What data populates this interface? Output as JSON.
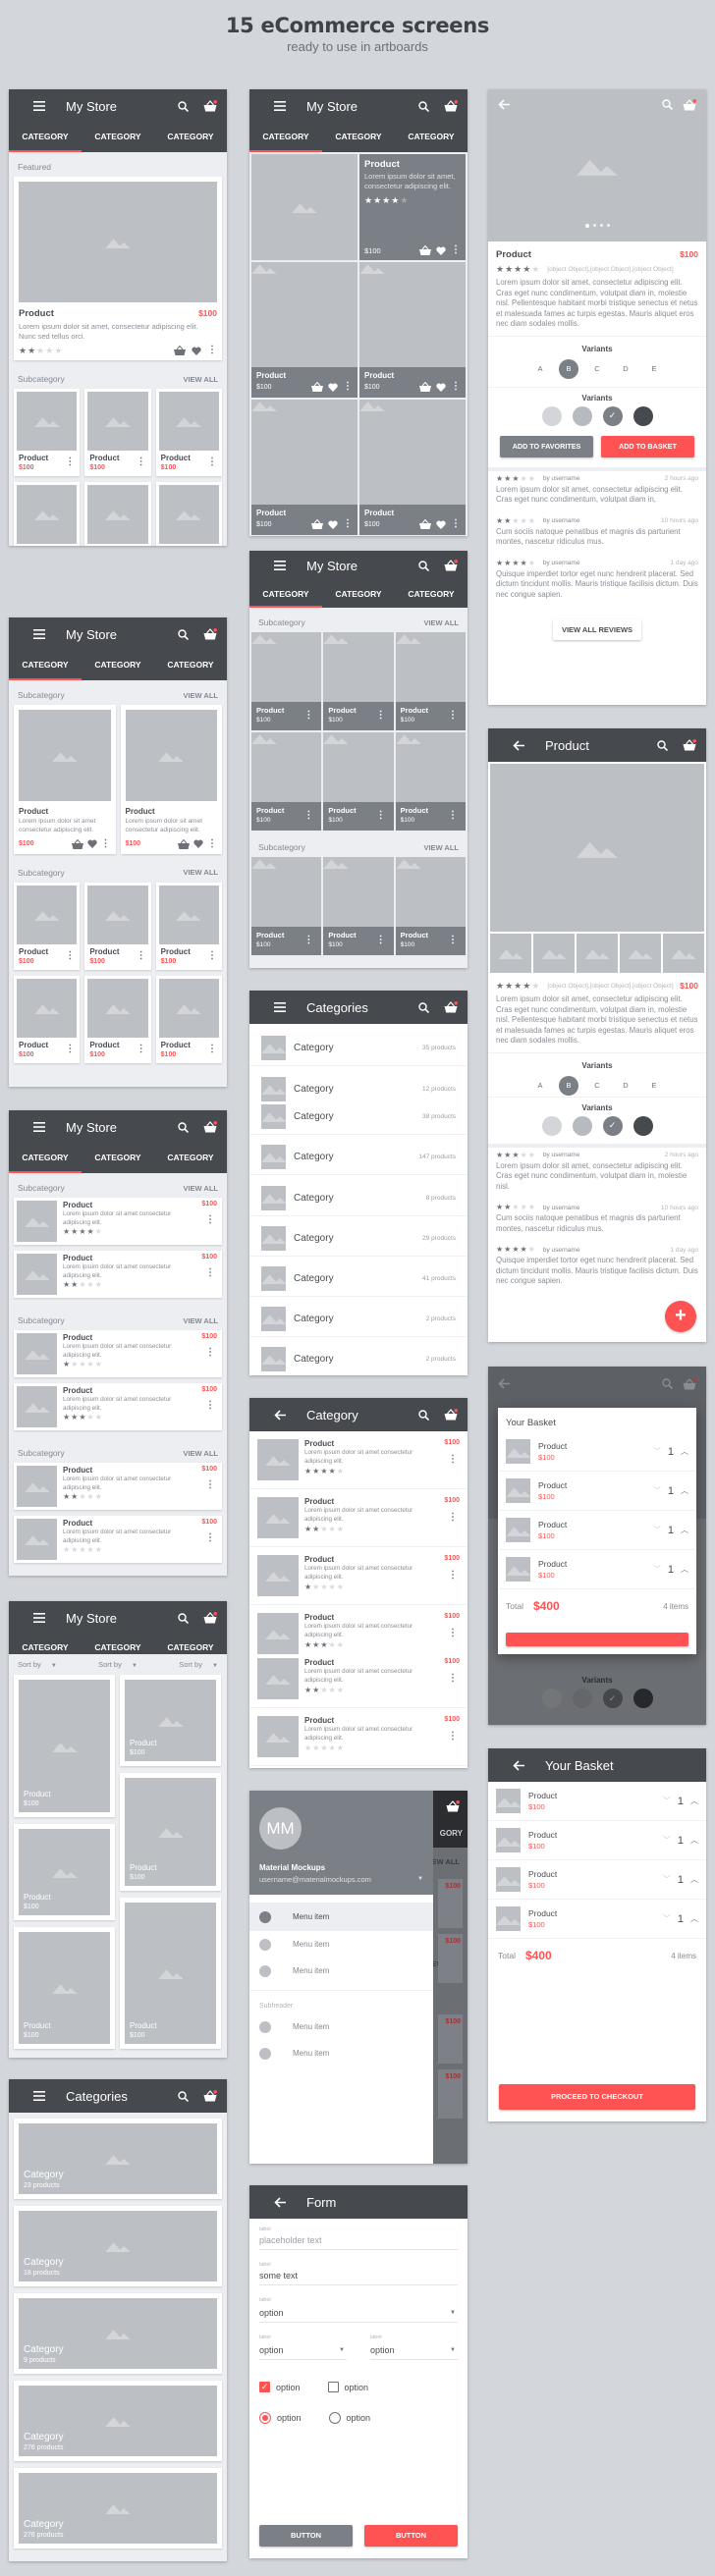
{
  "header": {
    "title": "15 eCommerce screens",
    "subtitle": "ready to use in artboards"
  },
  "colors": {
    "accent": "#ff5252",
    "appbar": "#46494e",
    "placeholder": "#bcbfc4"
  },
  "common": {
    "store_title": "My Store",
    "tab_label": "CATEGORY",
    "product": "Product",
    "price": "$100",
    "subcategory": "Subcategory",
    "view_all": "VIEW ALL",
    "featured": "Featured",
    "lorem_short": "Lorem ipsum dolor sit amet consectetur adipiscing elit.",
    "lorem_featured": "Lorem ipsum dolor sit amet, consectetur adipiscing elit. Nunc sed tellus orci.",
    "lorem_tile": "Lorem ipsum dolor sit amet, consectetur adipiscing elit.",
    "sort_by": "Sort by",
    "category": "Category"
  },
  "screen1": {
    "featured_rating": 2,
    "grid_count": 6
  },
  "screen2": {
    "featured_rating": 4
  },
  "screen_list": {
    "sections": [
      {
        "ratings": [
          4,
          2
        ]
      },
      {
        "ratings": [
          1,
          3
        ]
      },
      {
        "ratings": [
          2,
          0
        ]
      }
    ]
  },
  "categories_cards": {
    "title": "Categories",
    "items": [
      {
        "name": "Category",
        "count": "23 products"
      },
      {
        "name": "Category",
        "count": "18 products"
      },
      {
        "name": "Category",
        "count": "9 products"
      },
      {
        "name": "Category",
        "count": "276 products"
      },
      {
        "name": "Category",
        "count": "276 products"
      }
    ]
  },
  "categories_list": {
    "title": "Categories",
    "items": [
      {
        "name": "Category",
        "count": "35 products"
      },
      {
        "name": "Category",
        "count": "12 products"
      },
      {
        "name": "Category",
        "count": "38 products"
      },
      {
        "name": "Category",
        "count": "147 products"
      },
      {
        "name": "Category",
        "count": "8 products"
      },
      {
        "name": "Category",
        "count": "29 products"
      },
      {
        "name": "Category",
        "count": "41 products"
      },
      {
        "name": "Category",
        "count": "2 products"
      },
      {
        "name": "Category",
        "count": "2 products"
      }
    ]
  },
  "category_screen": {
    "title": "Category",
    "ratings": [
      4,
      2,
      1,
      3,
      2,
      0
    ]
  },
  "drawer": {
    "initials": "MM",
    "name": "Material Mockups",
    "email": "username@materialmockups.com",
    "items": [
      "Menu item",
      "Menu item",
      "Menu item"
    ],
    "subheader": "Subheader",
    "sub_items": [
      "Menu item",
      "Menu item"
    ],
    "behind_tab": "GORY",
    "behind_view_all": "EW ALL"
  },
  "form": {
    "title": "Form",
    "label": "label",
    "field1_placeholder": "placeholder text",
    "field2_value": "some text",
    "select_value": "option",
    "checkbox_label": "option",
    "radio_label": "option",
    "button1": "BUTTON",
    "button2": "BUTTON"
  },
  "product_detail": {
    "name": "Product",
    "price": "$100",
    "rating": 4,
    "reviews": [
      {
        "rating": 3,
        "by": "by username",
        "time": "2 hours ago",
        "text": "Lorem ipsum dolor sit amet, consectetur adipiscing elit. Cras eget nunc condimentum, volutpat diam in,"
      },
      {
        "rating": 2,
        "by": "by username",
        "time": "10 hours ago",
        "text": "Cum sociis natoque penatibus et magnis dis parturient montes, nascetur ridiculus mus."
      },
      {
        "rating": 4,
        "by": "by username",
        "time": "1 day ago",
        "text": "Quisque imperdiet tortor eget nunc hendrerit placerat. Sed dictum tincidunt mollis. Mauris tristique facilisis dictum.  Duis nec congue sapien."
      }
    ],
    "description": "Lorem ipsum dolor sit amet, consectetur adipiscing elit. Cras eget nunc condimentum, volutpat diam in, molestie nisl. Pellentesque habitant morbi tristique senectus et netus et malesuada fames ac turpis egestas. Mauris aliquet eros nec diam sodales mollis.",
    "variants_label": "Variants",
    "letter_variants": [
      "A",
      "B",
      "C",
      "D",
      "E"
    ],
    "selected_letter": "B",
    "color_variants": [
      "#d3d5d9",
      "#b7babf",
      "#7b7f86",
      "#46494e"
    ],
    "selected_color_index": 2,
    "add_favorites": "ADD TO FAVORITES",
    "add_basket": "ADD TO BASKET",
    "view_all_reviews": "VIEW ALL REVIEWS",
    "carousel_pages": 4,
    "carousel_current": 1
  },
  "product_detail2": {
    "title": "Product",
    "review1_text": "Lorem ipsum dolor sit amet, consectetur adipiscing elit. Cras eget nunc condimentum, volutpat diam in, molestie nisl.",
    "fab": "+"
  },
  "basket": {
    "title": "Your Basket",
    "items": [
      {
        "name": "Product",
        "price": "$100",
        "qty": "1"
      },
      {
        "name": "Product",
        "price": "$100",
        "qty": "1"
      },
      {
        "name": "Product",
        "price": "$100",
        "qty": "1"
      },
      {
        "name": "Product",
        "price": "$100",
        "qty": "1"
      }
    ],
    "total_label": "Total",
    "total": "$400",
    "count": "4 items",
    "checkout": "PROCEED TO CHECKOUT"
  }
}
